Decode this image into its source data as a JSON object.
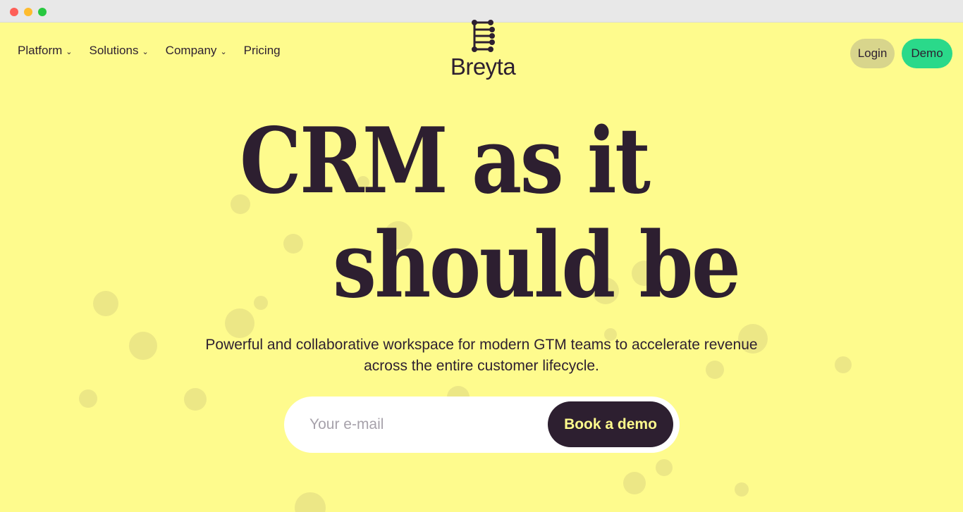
{
  "nav": {
    "items": [
      {
        "label": "Platform",
        "has_dropdown": true
      },
      {
        "label": "Solutions",
        "has_dropdown": true
      },
      {
        "label": "Company",
        "has_dropdown": true
      },
      {
        "label": "Pricing",
        "has_dropdown": false
      }
    ],
    "chevron": "⌄"
  },
  "logo": {
    "name": "Breyta",
    "icon": "connected-dots-icon"
  },
  "header_actions": {
    "login_label": "Login",
    "demo_label": "Demo"
  },
  "hero": {
    "headline_line1": "CRM as it",
    "headline_line2": "should be",
    "subtitle": "Powerful and collaborative workspace for modern GTM teams to accelerate revenue across the entire customer lifecycle."
  },
  "signup": {
    "email_placeholder": "Your e-mail",
    "email_value": "",
    "cta_label": "Book a demo"
  },
  "colors": {
    "background": "#fefb8d",
    "text": "#2d1f30",
    "demo_button": "#2ad98a",
    "login_button": "#d8d58c",
    "cta_button": "#2d1f30",
    "cta_text": "#fefb8d"
  }
}
